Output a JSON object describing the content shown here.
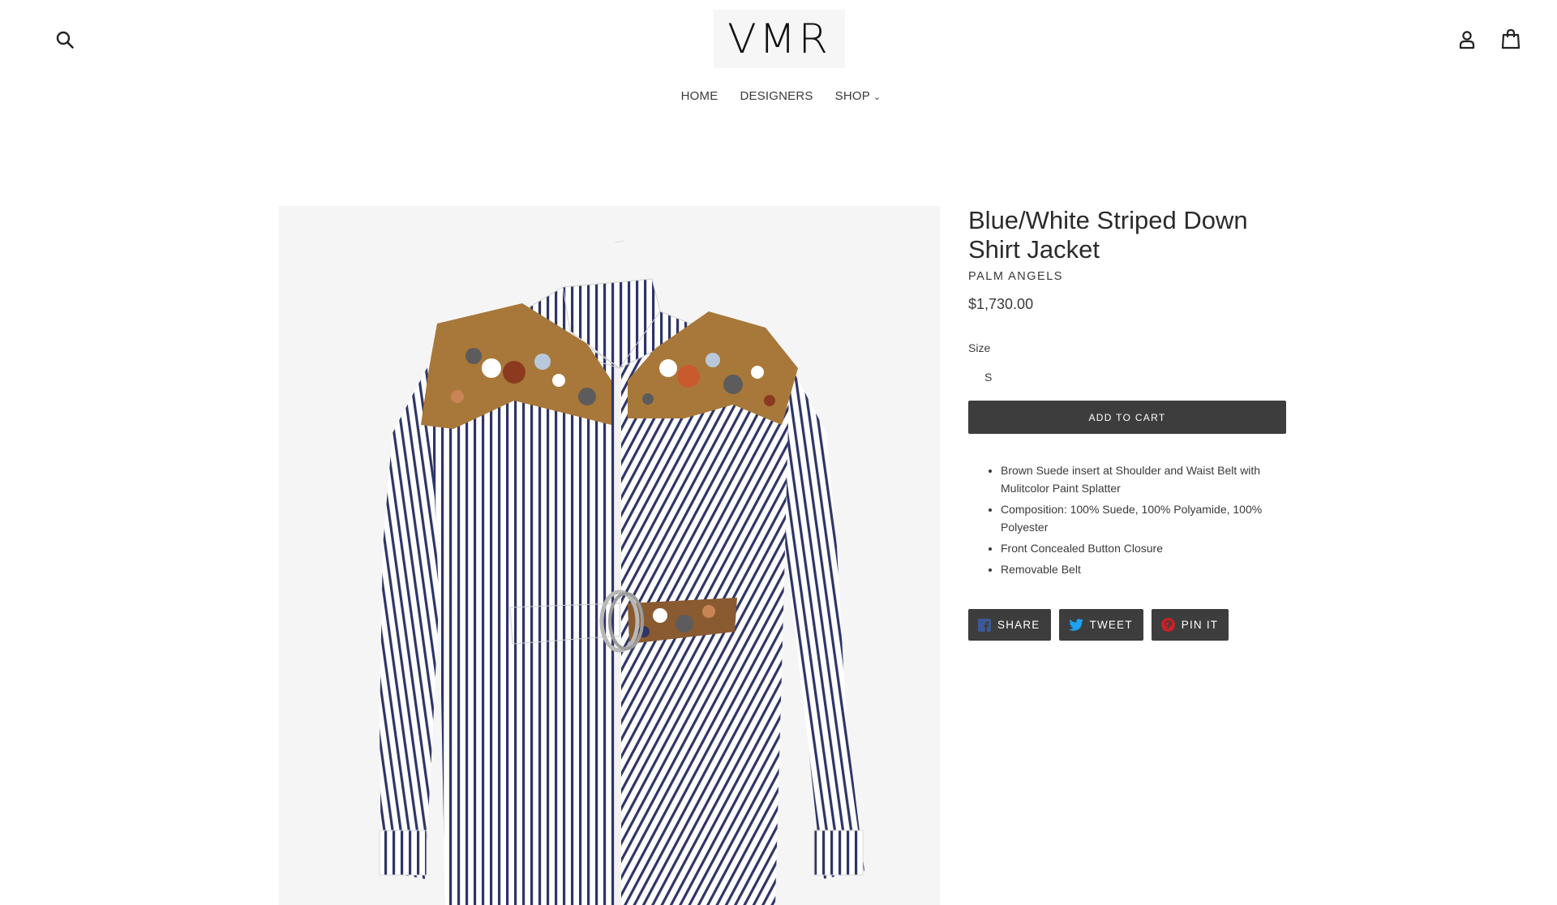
{
  "header": {
    "logo_text": "VMR",
    "icons": {
      "search": "search-icon",
      "account": "account-icon",
      "cart": "cart-icon"
    }
  },
  "nav": {
    "items": [
      {
        "label": "HOME"
      },
      {
        "label": "DESIGNERS"
      },
      {
        "label": "SHOP",
        "has_dropdown": true
      }
    ]
  },
  "product": {
    "title": "Blue/White Striped Down Shirt Jacket",
    "vendor": "PALM ANGELS",
    "price": "$1,730.00",
    "size_label": "Size",
    "size_selected": "S",
    "add_to_cart_label": "ADD TO CART",
    "description": [
      "Brown Suede insert at Shoulder and Waist Belt with Mulitcolor Paint Splatter",
      "Composition: 100% Suede, 100% Polyamide, 100% Polyester",
      "Front Concealed Button Closure",
      "Removable Belt"
    ]
  },
  "social": {
    "share_label": "SHARE",
    "tweet_label": "TWEET",
    "pin_label": "PIN IT"
  },
  "colors": {
    "button_bg": "#3d3d3d",
    "text": "#3a3a3a",
    "facebook": "#3b5998",
    "twitter": "#1da1f2",
    "pinterest": "#cb2027",
    "stripe": "#2e3566",
    "suede": "#a8783a"
  }
}
